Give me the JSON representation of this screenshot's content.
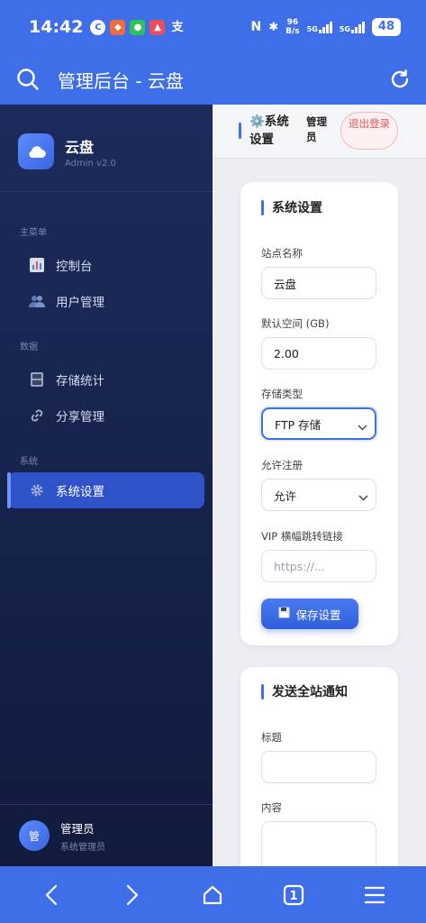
{
  "status_bar": {
    "time": "14:42",
    "net_speed_value": "96",
    "net_speed_unit": "B/s",
    "sig1": "5G",
    "sig2": "5G",
    "battery": "48"
  },
  "app_bar": {
    "title": "管理后台 - 云盘"
  },
  "sidebar": {
    "brand_name": "云盘",
    "brand_version": "Admin v2.0",
    "sections": [
      {
        "label": "主菜单",
        "items": [
          {
            "label": "控制台",
            "icon": "chart-icon"
          },
          {
            "label": "用户管理",
            "icon": "users-icon"
          }
        ]
      },
      {
        "label": "数据",
        "items": [
          {
            "label": "存储统计",
            "icon": "storage-icon"
          },
          {
            "label": "分享管理",
            "icon": "link-icon"
          }
        ]
      },
      {
        "label": "系统",
        "items": [
          {
            "label": "系统设置",
            "icon": "gear-icon",
            "active": true
          }
        ]
      }
    ],
    "footer": {
      "avatar": "管",
      "name": "管理员",
      "role": "系统管理员"
    }
  },
  "topbar": {
    "title": "⚙️系统设置",
    "admin": "管理员",
    "logout": "退出登录"
  },
  "settings_card": {
    "title": "系统设置",
    "site_name_label": "站点名称",
    "site_name_value": "云盘",
    "default_space_label": "默认空间 (GB)",
    "default_space_value": "2.00",
    "storage_type_label": "存储类型",
    "storage_type_value": "FTP 存储",
    "allow_register_label": "允许注册",
    "allow_register_value": "允许",
    "vip_link_label": "VIP 横幅跳转链接",
    "vip_link_placeholder": "https://...",
    "save_label": "保存设置"
  },
  "notify_card": {
    "title": "发送全站通知",
    "title_label": "标题",
    "content_label": "内容"
  },
  "colors": {
    "primary": "#3f6fe8",
    "sidebar_bg": "#1d2b5c",
    "active": "#2f52c9",
    "danger": "#e05757"
  }
}
